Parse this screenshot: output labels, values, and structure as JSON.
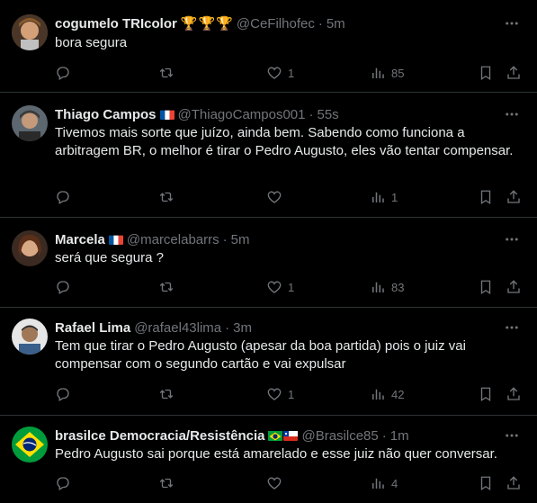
{
  "tweets": [
    {
      "name": "cogumelo TRIcolor",
      "handle": "@CeFilhofec",
      "time": "5m",
      "text": "bora segura",
      "badges": [
        "trophy-icon",
        "trophy-icon",
        "trophy-icon"
      ],
      "counts": {
        "replies": "",
        "retweets": "",
        "likes": "1",
        "views": "85"
      }
    },
    {
      "name": "Thiago Campos",
      "handle": "@ThiagoCampos001",
      "time": "55s",
      "text": "Tivemos mais sorte que juízo, ainda bem. Sabendo como funciona a arbitragem BR, o melhor é tirar o Pedro Augusto, eles vão tentar compensar.",
      "badges": [
        "france-flag-icon"
      ],
      "counts": {
        "replies": "",
        "retweets": "",
        "likes": "",
        "views": "1"
      }
    },
    {
      "name": "Marcela",
      "handle": "@marcelabarrs",
      "time": "5m",
      "text": "será que segura ?",
      "badges": [
        "france-flag-icon"
      ],
      "counts": {
        "replies": "",
        "retweets": "",
        "likes": "1",
        "views": "83"
      }
    },
    {
      "name": "Rafael Lima",
      "handle": "@rafael43lima",
      "time": "3m",
      "text": "Tem que tirar o Pedro Augusto (apesar da boa partida) pois o juiz vai compensar com o segundo cartão e vai expulsar",
      "badges": [],
      "counts": {
        "replies": "",
        "retweets": "",
        "likes": "1",
        "views": "42"
      }
    },
    {
      "name": "brasilce Democracia/Resistência",
      "handle": "@Brasilce85",
      "time": "1m",
      "text": "Pedro Augusto sai porque está amarelado e esse juiz não quer conversar.",
      "badges": [
        "brazil-flag-icon",
        "chile-flag-icon"
      ],
      "counts": {
        "replies": "",
        "retweets": "",
        "likes": "",
        "views": "4"
      }
    }
  ],
  "colors": {
    "background": "#000000",
    "text": "#e7e9ea",
    "muted": "#71767b",
    "divider": "#2f3336"
  }
}
